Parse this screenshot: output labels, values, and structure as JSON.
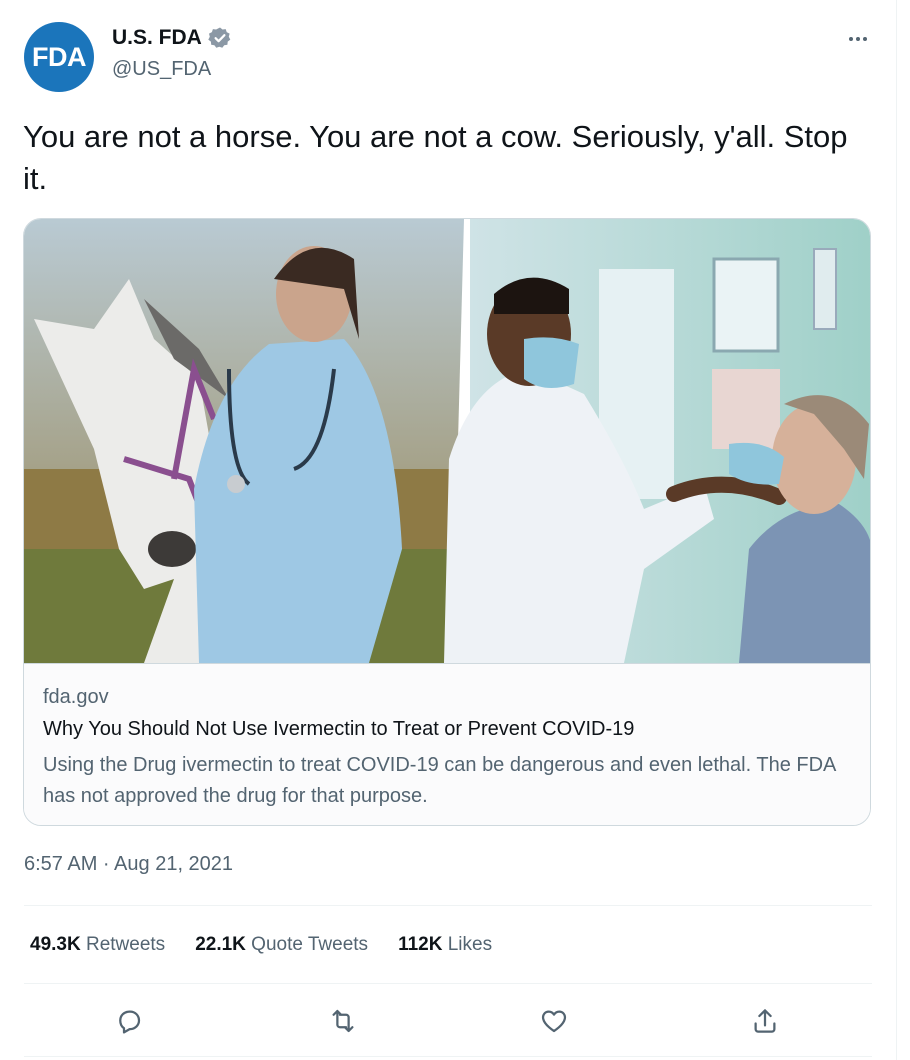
{
  "author": {
    "avatar_text": "FDA",
    "display_name": "U.S. FDA",
    "handle": "@US_FDA",
    "verified": true
  },
  "tweet": {
    "text": "You are not a horse. You are not a cow. Seriously, y'all. Stop it.",
    "timestamp": "6:57 AM · Aug 21, 2021"
  },
  "card": {
    "domain": "fda.gov",
    "title": "Why You Should Not Use Ivermectin to Treat or Prevent COVID-19",
    "description": "Using the Drug ivermectin to treat COVID-19 can be dangerous and even lethal. The FDA has not approved the drug for that purpose."
  },
  "stats": {
    "retweets_count": "49.3K",
    "retweets_label": "Retweets",
    "quotes_count": "22.1K",
    "quotes_label": "Quote Tweets",
    "likes_count": "112K",
    "likes_label": "Likes"
  },
  "icons": {
    "more": "more-icon",
    "reply": "reply-icon",
    "retweet": "retweet-icon",
    "like": "like-icon",
    "share": "share-icon",
    "verified": "verified-badge-icon"
  },
  "colors": {
    "brand_blue": "#1b75bb",
    "verified_badge": "#8b98a5",
    "secondary_text": "#536471",
    "primary_text": "#0f1419",
    "border": "#cfd9de"
  }
}
